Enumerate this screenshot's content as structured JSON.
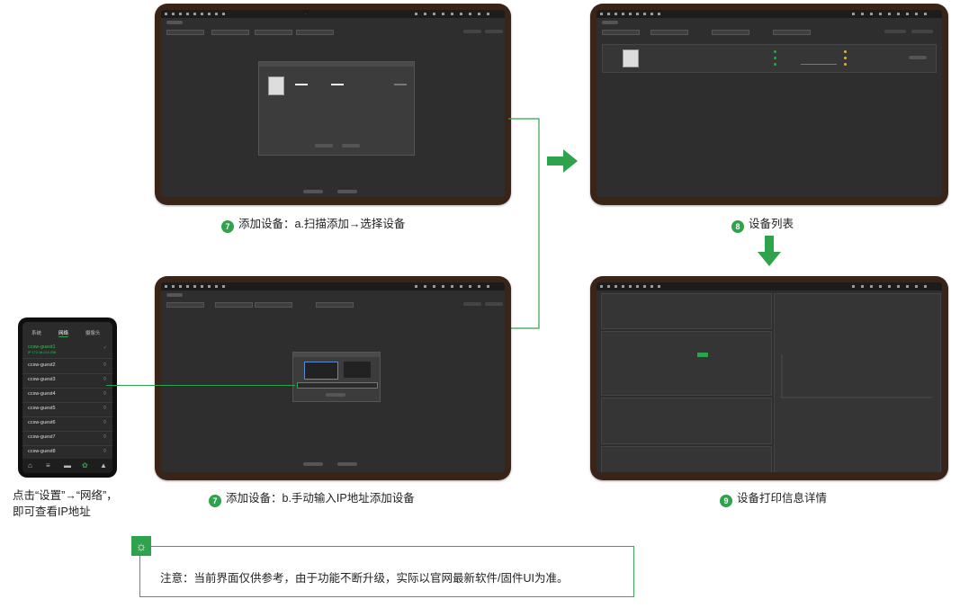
{
  "captions": {
    "cap1_num": "7",
    "cap1": "添加设备：a.扫描添加→选择设备",
    "cap2_num": "8",
    "cap2": "设备列表",
    "cap3_num": "7",
    "cap3": "添加设备：b.手动输入IP地址添加设备",
    "cap4_num": "9",
    "cap4": "设备打印信息详情",
    "phone_caption_line1": "点击“设置”→“网络”，",
    "phone_caption_line2": "即可查看IP地址"
  },
  "note": "注意：当前界面仅供参考，由于功能不断升级，实际以官网最新软件/固件UI为准。",
  "phone": {
    "tabs": [
      "系统",
      "网络",
      "摄像头"
    ],
    "active_tab": "网络",
    "networks": [
      {
        "name": "ccsw-guest1",
        "ip": "IP 172.18.214.238",
        "connected": true
      },
      {
        "name": "ccsw-guest2"
      },
      {
        "name": "ccsw-guest3"
      },
      {
        "name": "ccsw-guest4"
      },
      {
        "name": "ccsw-guest5"
      },
      {
        "name": "ccsw-guest6"
      },
      {
        "name": "ccsw-guest7"
      },
      {
        "name": "ccsw-guest8"
      }
    ]
  },
  "colors": {
    "accent": "#2fa34b",
    "tablet_frame": "#3a2418",
    "screen_bg": "#2e2e2e"
  }
}
